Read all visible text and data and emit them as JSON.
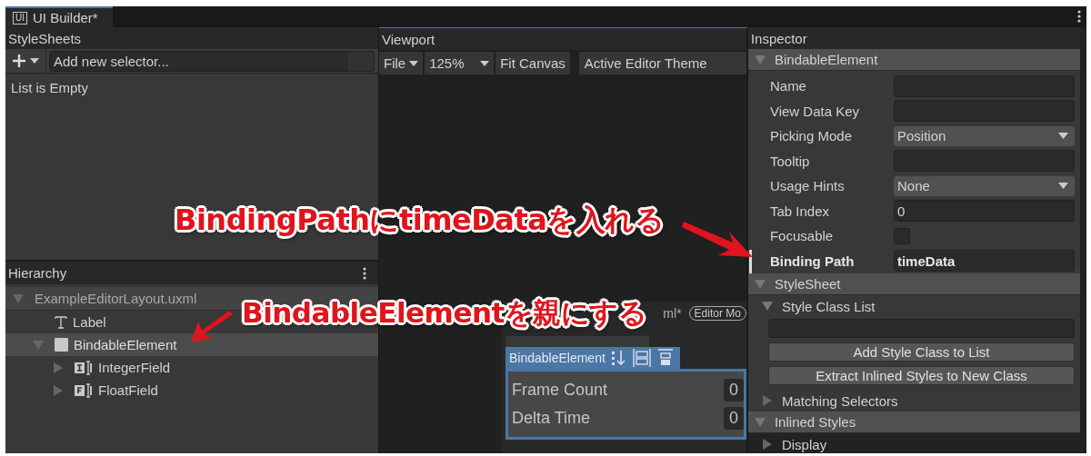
{
  "window": {
    "icon_text": "UI",
    "tab_title": "UI Builder*"
  },
  "stylesheets": {
    "title": "StyleSheets",
    "selector_placeholder": "Add new selector...",
    "empty_text": "List is Empty"
  },
  "hierarchy": {
    "title": "Hierarchy",
    "tree": [
      {
        "label": "ExampleEditorLayout.uxml",
        "kind": "document",
        "expanded": true,
        "selected": false,
        "children": [
          {
            "label": "Label",
            "kind": "label",
            "selected": false
          },
          {
            "label": "BindableElement",
            "kind": "element",
            "expanded": true,
            "selected": true,
            "children": [
              {
                "label": "IntegerField",
                "kind": "integer",
                "expanded": false,
                "selected": false
              },
              {
                "label": "FloatField",
                "kind": "float",
                "expanded": false,
                "selected": false
              }
            ]
          }
        ]
      }
    ]
  },
  "viewport": {
    "title": "Viewport",
    "toolbar": [
      {
        "label": "File",
        "kind": "menu"
      },
      {
        "label": "125%",
        "kind": "zoom"
      },
      {
        "label": "Fit Canvas",
        "kind": "button"
      },
      {
        "label": "Active Editor Theme",
        "kind": "theme"
      }
    ],
    "document_suffix": "ml*",
    "mode_badge": "Editor Mo",
    "element": {
      "title": "BindableElement",
      "fields": [
        {
          "label": "Frame Count",
          "value": "0"
        },
        {
          "label": "Delta Time",
          "value": "0"
        }
      ]
    }
  },
  "inspector": {
    "title": "Inspector",
    "element_section": {
      "title": "BindableElement",
      "expanded": true,
      "rows": [
        {
          "label": "Name",
          "kind": "text",
          "overridden": false
        },
        {
          "label": "View Data Key",
          "kind": "text",
          "overridden": false
        },
        {
          "label": "Picking Mode",
          "kind": "dropdown",
          "value": "Position",
          "overridden": false
        },
        {
          "label": "Tooltip",
          "kind": "text",
          "overridden": false
        },
        {
          "label": "Usage Hints",
          "kind": "dropdown",
          "value": "None",
          "overridden": false
        },
        {
          "label": "Tab Index",
          "kind": "text",
          "value": "0",
          "overridden": false
        },
        {
          "label": "Focusable",
          "kind": "checkbox",
          "checked": false,
          "overridden": false
        },
        {
          "label": "Binding Path",
          "kind": "text",
          "value": "timeData",
          "overridden": true
        }
      ]
    },
    "stylesheet_section": {
      "title": "StyleSheet",
      "expanded": true,
      "class_list": {
        "title": "Style Class List",
        "expanded": true,
        "buttons": [
          "Add Style Class to List",
          "Extract Inlined Styles to New Class"
        ]
      },
      "matching_selectors": {
        "title": "Matching Selectors",
        "expanded": false
      }
    },
    "inlined_styles": {
      "title": "Inlined Styles",
      "expanded": true,
      "children": [
        {
          "title": "Display",
          "expanded": false
        }
      ]
    }
  },
  "annotations": [
    {
      "text": "BindingPathにtimeDataを入れる"
    },
    {
      "text": "BindableElementを親にする"
    }
  ]
}
